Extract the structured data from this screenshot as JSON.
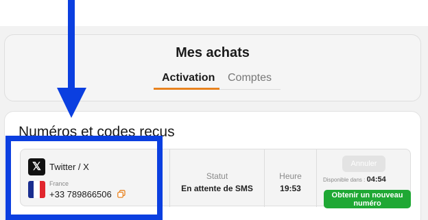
{
  "achats": {
    "title": "Mes achats",
    "tabs": [
      {
        "label": "Activation",
        "active": true
      },
      {
        "label": "Comptes",
        "active": false
      }
    ]
  },
  "numeros": {
    "title": "Numéros et codes reçus",
    "row": {
      "service_icon": "x-logo-icon",
      "service": "Twitter / X",
      "country": "France",
      "country_flag": "france-flag-icon",
      "phone": "+33 789866506",
      "copy_icon": "copy-icon",
      "statut_label": "Statut",
      "statut_value": "En attente de SMS",
      "heure_label": "Heure",
      "heure_value": "19:53",
      "annuler_label": "Annuler",
      "disponible_label": "Disponible dans :",
      "disponible_time": "04:54",
      "obtenir_label": "Obtenir un nouveau numéro"
    }
  },
  "colors": {
    "accent": "#e8821f",
    "success": "#1fa834",
    "annotation": "#0b3fe0"
  }
}
